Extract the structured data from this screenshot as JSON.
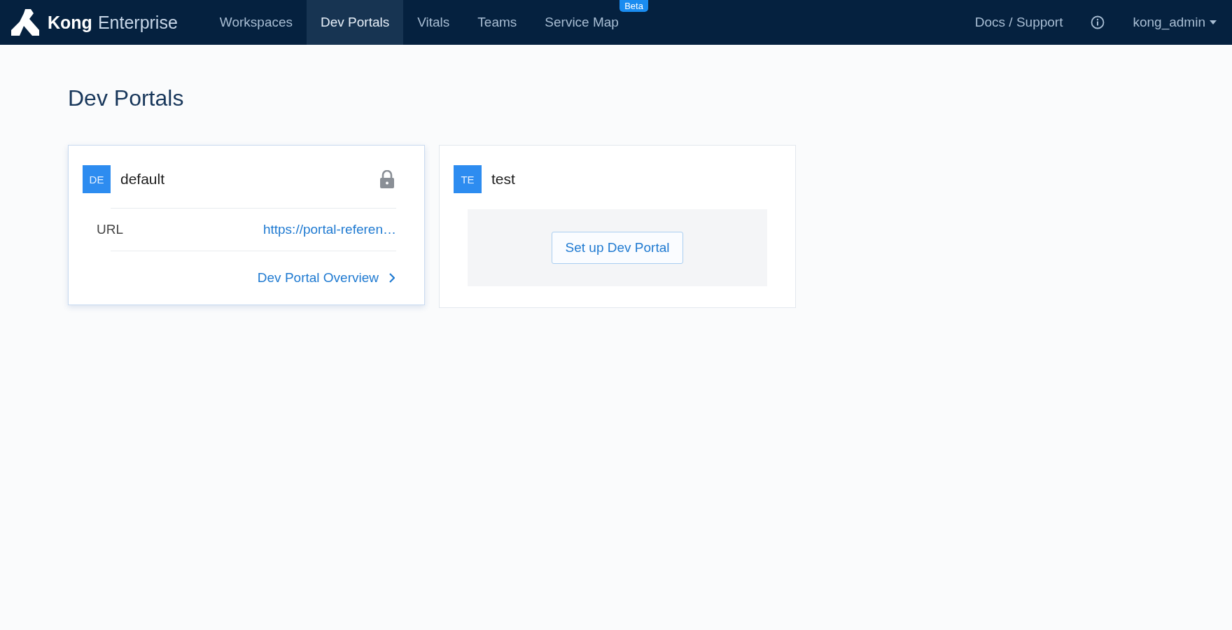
{
  "header": {
    "brand": "Kong",
    "product": "Enterprise",
    "nav": [
      {
        "label": "Workspaces",
        "selected": false
      },
      {
        "label": "Dev Portals",
        "selected": true
      },
      {
        "label": "Vitals",
        "selected": false
      },
      {
        "label": "Teams",
        "selected": false
      },
      {
        "label": "Service Map",
        "selected": false,
        "badge": "Beta"
      }
    ],
    "docs_link": "Docs / Support",
    "user": "kong_admin"
  },
  "page_title": "Dev Portals",
  "portals": [
    {
      "kind": "configured",
      "initials": "DE",
      "name": "default",
      "locked": true,
      "url_label": "URL",
      "url": "https://portal-referen…",
      "overview_link": "Dev Portal Overview"
    },
    {
      "kind": "set_up",
      "initials": "TE",
      "name": "test",
      "locked": false,
      "button": "Set up Dev Portal"
    }
  ]
}
